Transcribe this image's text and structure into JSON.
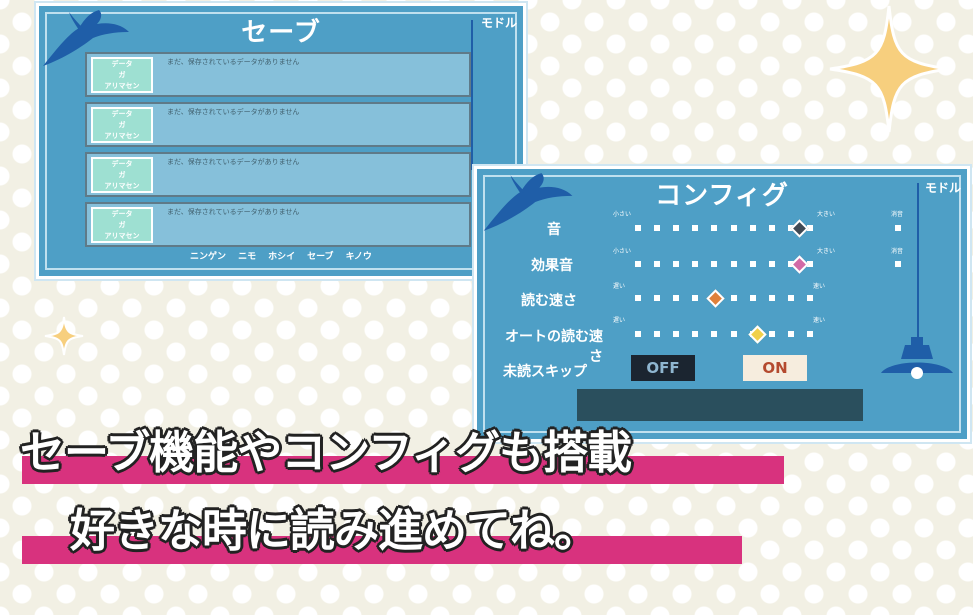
{
  "save_screen": {
    "title": "セーブ",
    "back_label": "モドル",
    "slots": [
      {
        "thumb_line1": "データ",
        "thumb_line2": "ガ",
        "thumb_line3": "アリマセン",
        "message": "まだ、保存されているデータがありません"
      },
      {
        "thumb_line1": "データ",
        "thumb_line2": "ガ",
        "thumb_line3": "アリマセン",
        "message": "まだ、保存されているデータがありません"
      },
      {
        "thumb_line1": "データ",
        "thumb_line2": "ガ",
        "thumb_line3": "アリマセン",
        "message": "まだ、保存されているデータがありません"
      },
      {
        "thumb_line1": "データ",
        "thumb_line2": "ガ",
        "thumb_line3": "アリマセン",
        "message": "まだ、保存されているデータがありません"
      }
    ],
    "menu": [
      "ニンゲン",
      "ニモ",
      "ホシイ",
      "セーブ",
      "キノウ"
    ]
  },
  "config_screen": {
    "title": "コンフィグ",
    "back_label": "モドル",
    "rows": [
      {
        "label": "音",
        "left_hint": "小さい",
        "right_hint": "大きい",
        "mute_label": "消音",
        "level": 0.95,
        "knob_color": "#3f4a55"
      },
      {
        "label": "効果音",
        "left_hint": "小さい",
        "right_hint": "大きい",
        "mute_label": "消音",
        "level": 0.95,
        "knob_color": "#d26aa7"
      },
      {
        "label": "読む速さ",
        "left_hint": "遅い",
        "right_hint": "速い",
        "level": 0.45,
        "knob_color": "#e0803a"
      },
      {
        "label": "オートの読む速さ",
        "left_hint": "遅い",
        "right_hint": "速い",
        "level": 0.7,
        "knob_color": "#f0d04a"
      }
    ],
    "skip_label": "未読スキップ",
    "off_label": "OFF",
    "on_label": "ON"
  },
  "caption": {
    "line1": "セーブ機能やコンフィグも搭載",
    "line2": "好きな時に読み進めてね。"
  },
  "colors": {
    "panel": "#4e9fc6",
    "stripe": "#d8327e",
    "sparkle": "#f7cf7e"
  }
}
